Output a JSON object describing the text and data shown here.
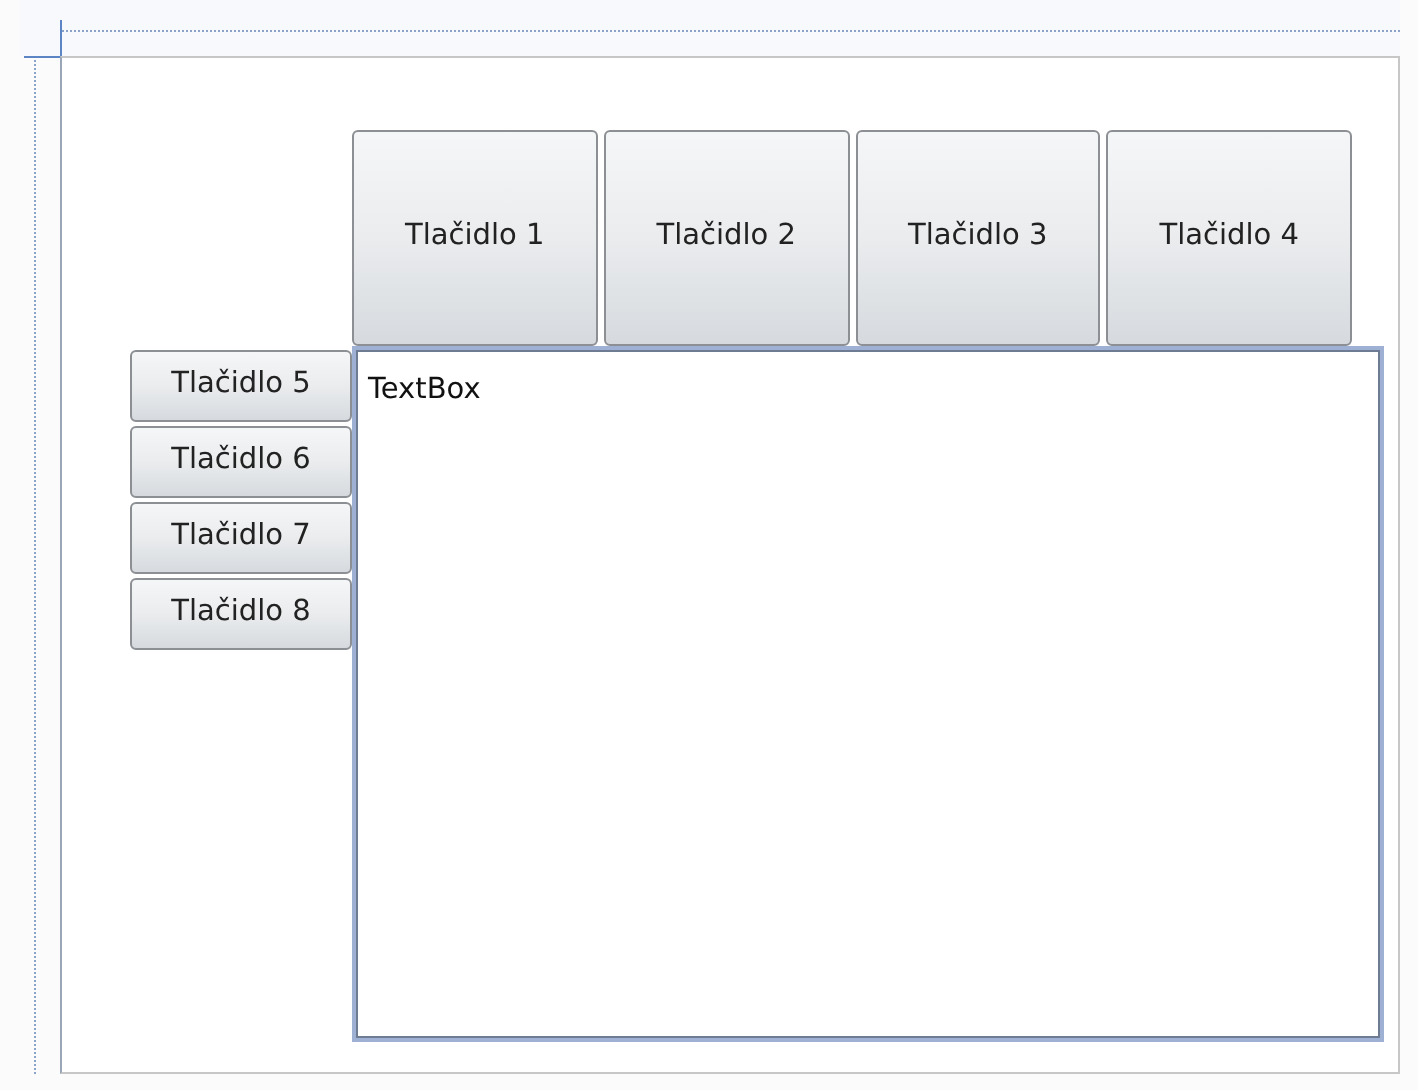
{
  "top_buttons": [
    {
      "label": "Tlačidlo 1"
    },
    {
      "label": "Tlačidlo 2"
    },
    {
      "label": "Tlačidlo 3"
    },
    {
      "label": "Tlačidlo 4"
    }
  ],
  "side_buttons": [
    {
      "label": "Tlačidlo 5"
    },
    {
      "label": "Tlačidlo 6"
    },
    {
      "label": "Tlačidlo 7"
    },
    {
      "label": "Tlačidlo 8"
    }
  ],
  "textbox": {
    "value": "TextBox"
  }
}
